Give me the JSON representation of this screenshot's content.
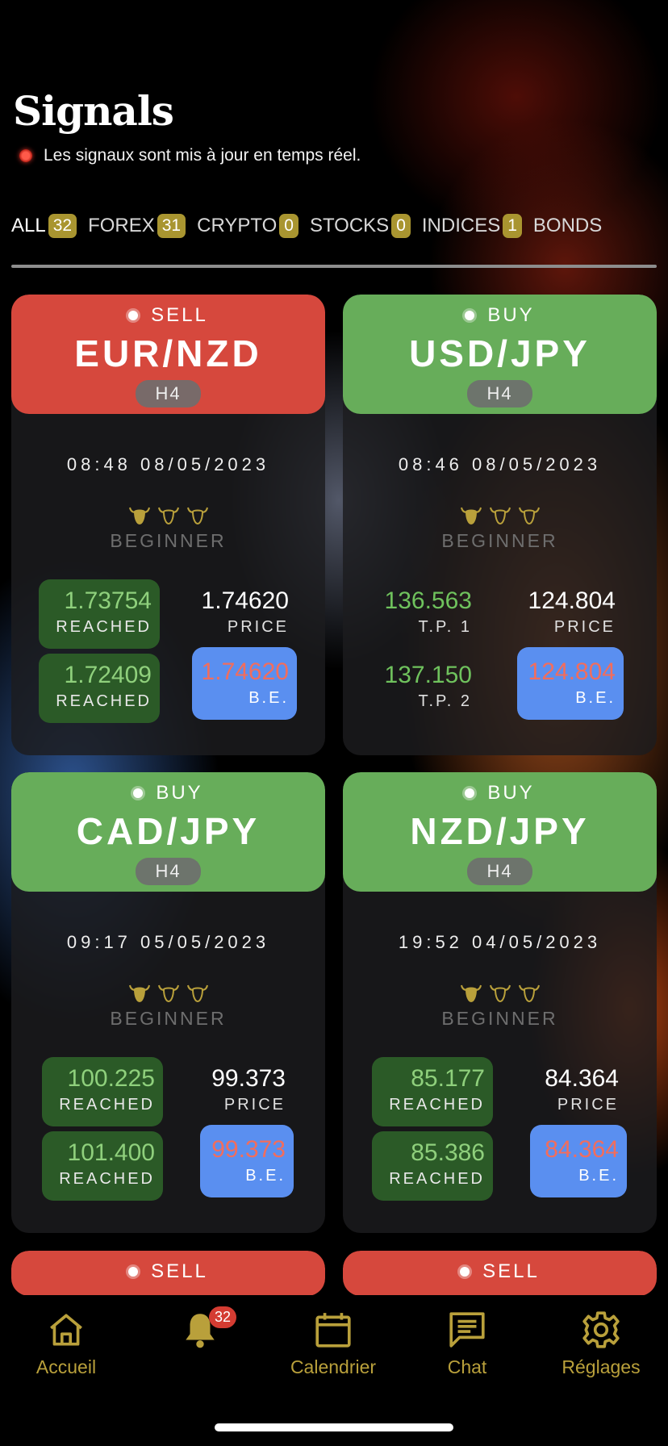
{
  "header": {
    "title": "Signals",
    "subtitle": "Les signaux sont mis à jour en temps réel."
  },
  "tabs": [
    {
      "label": "ALL",
      "count": "32",
      "active": true
    },
    {
      "label": "FOREX",
      "count": "31"
    },
    {
      "label": "CRYPTO",
      "count": "0"
    },
    {
      "label": "STOCKS",
      "count": "0"
    },
    {
      "label": "INDICES",
      "count": "1"
    },
    {
      "label": "BONDS",
      "count": ""
    }
  ],
  "cards": [
    {
      "side": "SELL",
      "pair": "EUR/NZD",
      "timeframe": "H4",
      "time": "08:48 08/05/2023",
      "level": "BEGINNER",
      "top_left": {
        "value": "1.73754",
        "label": "REACHED"
      },
      "top_right": {
        "value": "1.74620",
        "label": "PRICE"
      },
      "bottom_left": {
        "value": "1.72409",
        "label": "REACHED"
      },
      "bottom_right": {
        "value": "1.74620",
        "label": "B.E."
      }
    },
    {
      "side": "BUY",
      "pair": "USD/JPY",
      "timeframe": "H4",
      "time": "08:46 08/05/2023",
      "level": "BEGINNER",
      "top_left": {
        "value": "136.563",
        "label": "T.P. 1"
      },
      "top_right": {
        "value": "124.804",
        "label": "PRICE"
      },
      "bottom_left": {
        "value": "137.150",
        "label": "T.P. 2"
      },
      "bottom_right": {
        "value": "124.804",
        "label": "B.E."
      }
    },
    {
      "side": "BUY",
      "pair": "CAD/JPY",
      "timeframe": "H4",
      "time": "09:17 05/05/2023",
      "level": "BEGINNER",
      "top_left": {
        "value": "100.225",
        "label": "REACHED"
      },
      "top_right": {
        "value": "99.373",
        "label": "PRICE"
      },
      "bottom_left": {
        "value": "101.400",
        "label": "REACHED"
      },
      "bottom_right": {
        "value": "99.373",
        "label": "B.E."
      }
    },
    {
      "side": "BUY",
      "pair": "NZD/JPY",
      "timeframe": "H4",
      "time": "19:52 04/05/2023",
      "level": "BEGINNER",
      "top_left": {
        "value": "85.177",
        "label": "REACHED"
      },
      "top_right": {
        "value": "84.364",
        "label": "PRICE"
      },
      "bottom_left": {
        "value": "85.386",
        "label": "REACHED"
      },
      "bottom_right": {
        "value": "84.364",
        "label": "B.E."
      }
    }
  ],
  "partial_cards": [
    {
      "side": "SELL"
    },
    {
      "side": "SELL"
    }
  ],
  "nav": {
    "home": "Accueil",
    "notifications_badge": "32",
    "calendar": "Calendrier",
    "chat": "Chat",
    "settings": "Réglages"
  },
  "colors": {
    "sell": "#d6483d",
    "buy": "#67ad5a",
    "accent_gold": "#b9a03b",
    "reached_bg": "#2b5a27",
    "be_bg": "#5a8ff0"
  }
}
